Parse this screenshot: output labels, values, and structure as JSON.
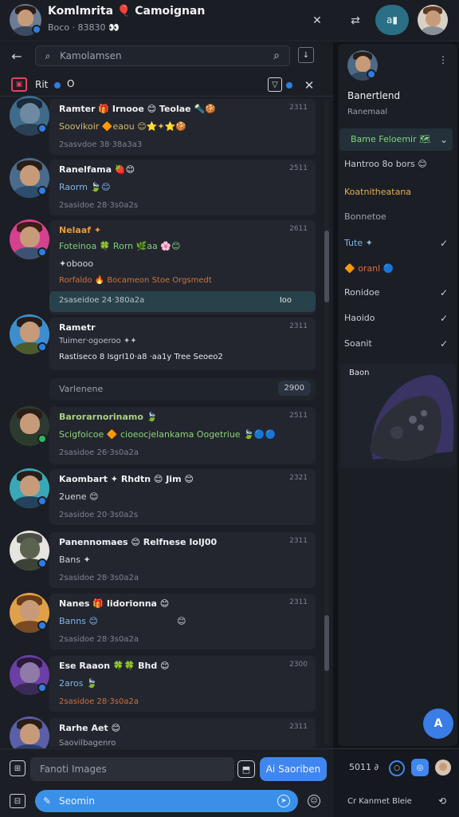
{
  "header": {
    "title": "Komlmrita 🎈 Camoignan",
    "subtitle": "Boco · 83830 👀",
    "pill_label": "a▮"
  },
  "search": {
    "placeholder": "Kamolamsen"
  },
  "filter": {
    "label": "Rit",
    "count": "O"
  },
  "messages": [
    {
      "name": "Ramter 🎁 Irnooe 😊 Teolae 🔦🍪",
      "line1": "Soovikoir 🔶eaou 😊⭐✦⭐🍪",
      "meta": "2sasvdoe 38·38a3a3",
      "time": "2311"
    },
    {
      "name": "Ranelfama 🍓😊",
      "line1": "Raorm 🍃😊",
      "meta": "2sasidoe 28·3s0a2s",
      "time": "2511"
    },
    {
      "name": "Nelaaf ✦",
      "line1": "Foteinoa 🍀 Rorn 🌿aa 🌸😊",
      "line2": "✦obooo",
      "meta": "Rorfaldo 🔥 Bocameon Stoe Orgsmedt",
      "time": "2611",
      "highlight": "2saseidoe 24·380a2a",
      "highlight_right": "Ioo"
    },
    {
      "name": "Rametr",
      "line1": "Tuimer·ogoeroo ✦✦",
      "line2": "Rastiseco 8 IsgrI10·a8 ·aa1y Tree Seoeo2",
      "time": "2311"
    },
    {
      "name": "Barorarnorinamo 🍃",
      "line1": "Scigfoicoe 🔶 cioeocjelankama Oogetriue 🍃🔵🔵",
      "meta": "2sasidoe 26·3s0a2a",
      "time": "2511"
    },
    {
      "name": "Kaombart ✦ Rhdtn 😊 Jim 😊",
      "line1": "2uene 😊",
      "meta": "2sasidoe 20·3s0a2s",
      "time": "2321"
    },
    {
      "name": "Panennomaes 😊 Relfnese IolJ00",
      "line1": "Bans ✦",
      "meta": "2sasidoe 28·3s0a2a",
      "time": "2311"
    },
    {
      "name": "Nanes 🎁 Iidorionna 😊",
      "line1": "Banns 😊",
      "line1b": "😊",
      "meta": "2sasidoe 28·3s0a2a",
      "time": "2311"
    },
    {
      "name": "Ese Raaon 🍀🍀 Bhd 😊",
      "line1": "2aros 🍃",
      "meta": "2sasidoe 28·3s0a2a",
      "time": "2300"
    },
    {
      "name": "Rarhe Aet 😊",
      "line1": "Saovilbagenro",
      "time": "2311"
    }
  ],
  "separator": {
    "label": "Varlenene",
    "time": "2900"
  },
  "composer": {
    "find_placeholder": "Fanoti Images",
    "action_label": "Ai Saoriben",
    "send_placeholder": "Seomin"
  },
  "right_panel": {
    "profile_name": "Banertlend",
    "profile_sub": "Ranemaal",
    "items": [
      {
        "label": "Bame Feloemir 🗺",
        "selected": true,
        "check": false
      },
      {
        "label": "Hantroo 8o bors 😊",
        "selected": false,
        "check": false
      },
      {
        "label": "Koatnitheatana",
        "selected": false,
        "check": false
      },
      {
        "label": "Bonnetoe",
        "selected": false,
        "check": false
      },
      {
        "label": "Tute ✦",
        "selected": false,
        "check": true
      },
      {
        "label": "🔶 oranl 🔵",
        "selected": false,
        "check": false
      },
      {
        "label": "Ronidoe",
        "selected": false,
        "check": true
      },
      {
        "label": "Haoido",
        "selected": false,
        "check": true
      },
      {
        "label": "Soanit",
        "selected": false,
        "check": true
      }
    ],
    "card_label": "Baon",
    "bottom_time": "5011 ∂",
    "bottom_text": "Cr Kanmet Bleie"
  },
  "colors": {
    "accent": "#3f86f0",
    "highlight": "#27424a",
    "selected_text": "#7fd57a"
  }
}
